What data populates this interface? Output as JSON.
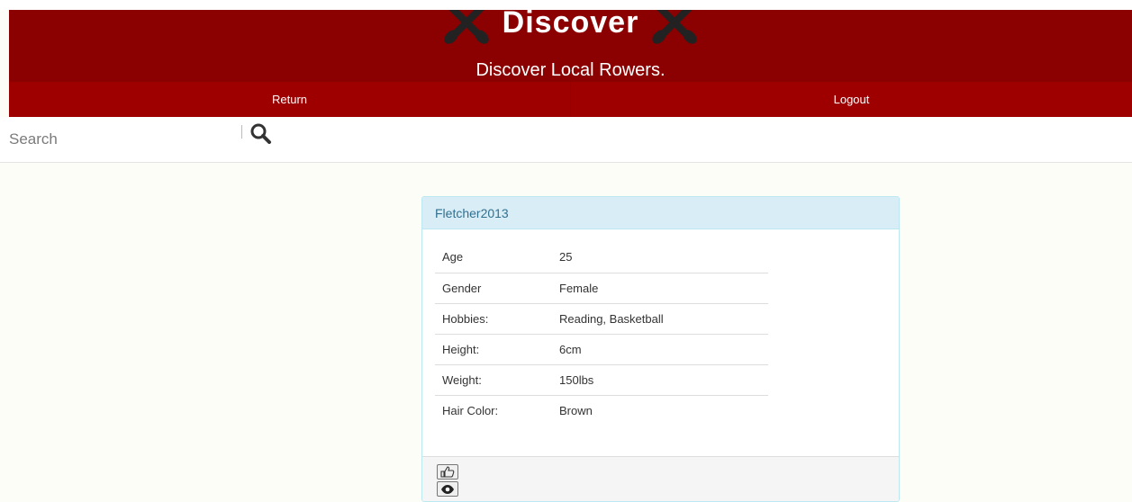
{
  "header": {
    "title": "Discover",
    "subtitle": "Discover Local Rowers.",
    "icons": [
      "crossed-oars-icon",
      "crossed-oars-icon"
    ]
  },
  "nav": {
    "return_label": "Return",
    "logout_label": "Logout"
  },
  "search": {
    "placeholder": "Search",
    "icon": "search-icon"
  },
  "profile": {
    "username": "Fletcher2013",
    "fields": [
      {
        "label": "Age",
        "value": "25"
      },
      {
        "label": "Gender",
        "value": "Female"
      },
      {
        "label": "Hobbies:",
        "value": "Reading, Basketball"
      },
      {
        "label": "Height:",
        "value": "6cm"
      },
      {
        "label": "Weight:",
        "value": "150lbs"
      },
      {
        "label": "Hair Color:",
        "value": "Brown"
      }
    ],
    "actions": [
      "thumbs-up-icon",
      "eye-icon"
    ]
  },
  "colors": {
    "header_bg": "#8b0000",
    "nav_bg": "#9e0000",
    "card_heading_bg": "#d9edf7",
    "card_heading_text": "#31708f",
    "page_bg": "#fdfdf8"
  }
}
